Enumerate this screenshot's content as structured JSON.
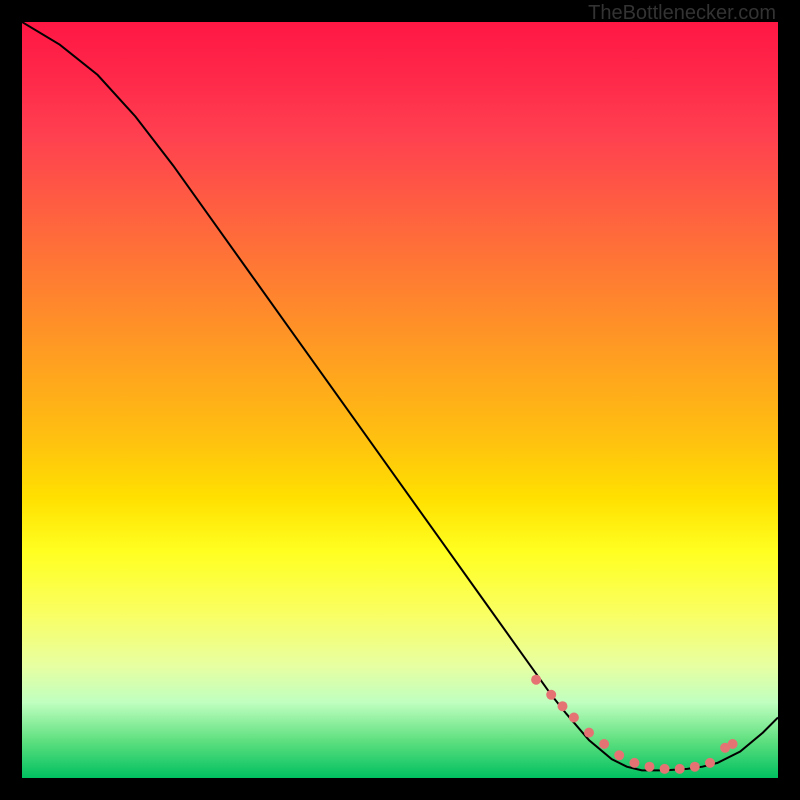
{
  "watermark": "TheBottlenecker.com",
  "chart_data": {
    "type": "line",
    "title": "",
    "xlabel": "",
    "ylabel": "",
    "xlim": [
      0,
      100
    ],
    "ylim": [
      0,
      100
    ],
    "x": [
      0,
      5,
      10,
      15,
      20,
      25,
      30,
      35,
      40,
      45,
      50,
      55,
      60,
      65,
      70,
      72,
      75,
      78,
      80,
      82,
      85,
      88,
      90,
      92,
      95,
      98,
      100
    ],
    "y": [
      100,
      97,
      93,
      87.5,
      81,
      74,
      67,
      60,
      53,
      46,
      39,
      32,
      25,
      18,
      11,
      8.5,
      5,
      2.5,
      1.5,
      1,
      1,
      1.2,
      1.5,
      2,
      3.5,
      6,
      8
    ],
    "markers": {
      "color": "#e57373",
      "points_x": [
        68,
        70,
        71.5,
        73,
        75,
        77,
        79,
        81,
        83,
        85,
        87,
        89,
        91,
        93,
        94
      ],
      "points_y": [
        13,
        11,
        9.5,
        8,
        6,
        4.5,
        3,
        2,
        1.5,
        1.2,
        1.2,
        1.5,
        2,
        4,
        4.5
      ]
    }
  }
}
